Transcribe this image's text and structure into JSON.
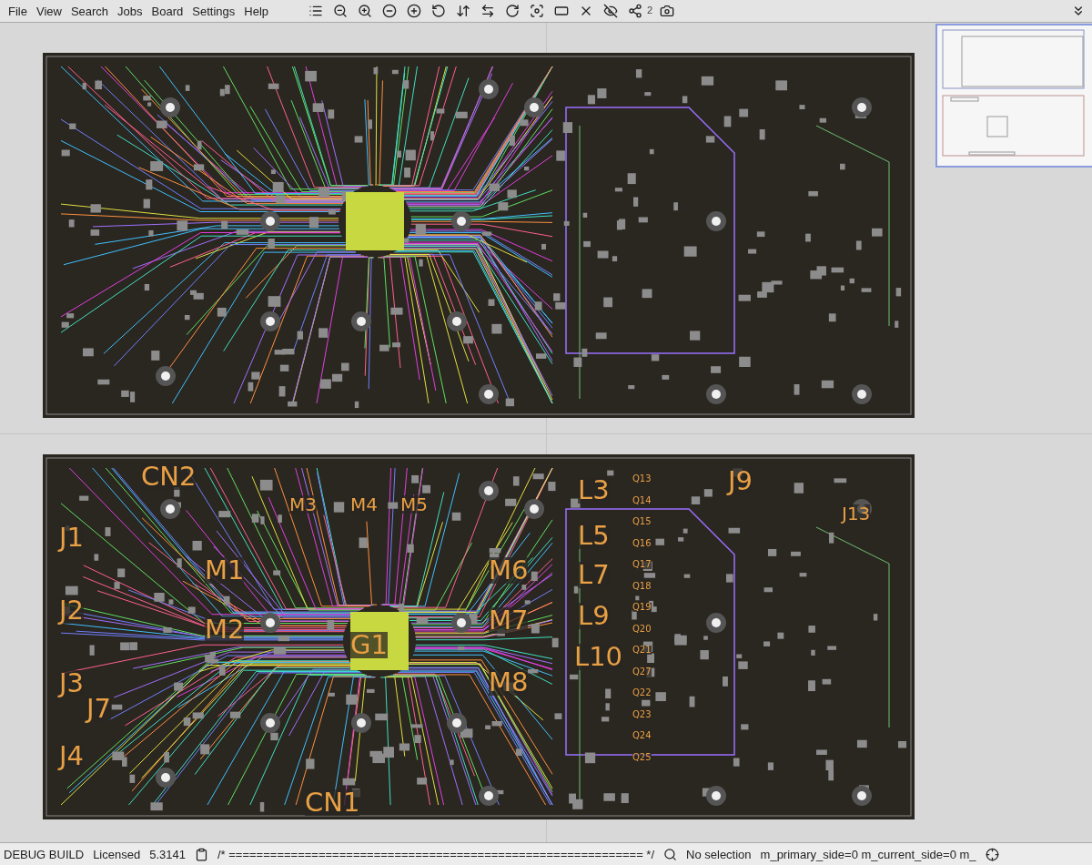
{
  "menu": [
    "File",
    "View",
    "Search",
    "Jobs",
    "Board",
    "Settings",
    "Help"
  ],
  "toolbar": {
    "badge": "2"
  },
  "bottom_board": {
    "designators": [
      {
        "text": "CN2",
        "kind": "major"
      },
      {
        "text": "J1",
        "kind": "major"
      },
      {
        "text": "J2",
        "kind": "major"
      },
      {
        "text": "J3",
        "kind": "major"
      },
      {
        "text": "J7",
        "kind": "major"
      },
      {
        "text": "J4",
        "kind": "major"
      },
      {
        "text": "CN1",
        "kind": "major"
      },
      {
        "text": "M3",
        "kind": "medium"
      },
      {
        "text": "M4",
        "kind": "medium"
      },
      {
        "text": "M5",
        "kind": "medium"
      },
      {
        "text": "M1",
        "kind": "major"
      },
      {
        "text": "M2",
        "kind": "major"
      },
      {
        "text": "M6",
        "kind": "major"
      },
      {
        "text": "M7",
        "kind": "major"
      },
      {
        "text": "M8",
        "kind": "major"
      },
      {
        "text": "G1",
        "kind": "major"
      },
      {
        "text": "L3",
        "kind": "major"
      },
      {
        "text": "L5",
        "kind": "major"
      },
      {
        "text": "L7",
        "kind": "major"
      },
      {
        "text": "L9",
        "kind": "major"
      },
      {
        "text": "L10",
        "kind": "major"
      },
      {
        "text": "J9",
        "kind": "major"
      },
      {
        "text": "J13",
        "kind": "medium"
      },
      {
        "text": "Q13",
        "kind": "minor"
      },
      {
        "text": "Q14",
        "kind": "minor"
      },
      {
        "text": "Q15",
        "kind": "minor"
      },
      {
        "text": "Q16",
        "kind": "minor"
      },
      {
        "text": "Q17",
        "kind": "minor"
      },
      {
        "text": "Q18",
        "kind": "minor"
      },
      {
        "text": "Q19",
        "kind": "minor"
      },
      {
        "text": "Q20",
        "kind": "minor"
      },
      {
        "text": "Q21",
        "kind": "minor"
      },
      {
        "text": "Q27",
        "kind": "minor"
      },
      {
        "text": "Q22",
        "kind": "minor"
      },
      {
        "text": "Q23",
        "kind": "minor"
      },
      {
        "text": "Q24",
        "kind": "minor"
      },
      {
        "text": "Q25",
        "kind": "minor"
      }
    ]
  },
  "status_bar": {
    "build": "DEBUG BUILD",
    "license": "Licensed",
    "version": "5.3141",
    "comment": "/* ============================================================ */",
    "selection": "No selection",
    "debug": "m_primary_side=0 m_current_side=0 m_"
  }
}
